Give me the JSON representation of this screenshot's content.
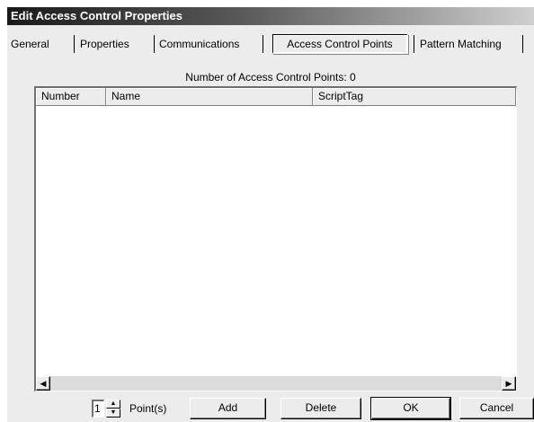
{
  "window": {
    "title": "Edit Access Control Properties"
  },
  "tabs": [
    {
      "label": "General"
    },
    {
      "label": "Properties"
    },
    {
      "label": "Communications"
    },
    {
      "label": "Access Control Points",
      "active": true
    },
    {
      "label": "Pattern Matching"
    }
  ],
  "summary": {
    "count_label": "Number of Access Control Points: 0"
  },
  "table": {
    "columns": [
      "Number",
      "Name",
      "ScriptTag"
    ],
    "rows": []
  },
  "scrollbar": {
    "left_icon": "scroll-left-arrow-icon",
    "right_icon": "scroll-right-arrow-icon"
  },
  "footer": {
    "points_value": "1",
    "points_label": "Point(s)",
    "add_label": "Add",
    "delete_label": "Delete",
    "ok_label": "OK",
    "cancel_label": "Cancel"
  }
}
